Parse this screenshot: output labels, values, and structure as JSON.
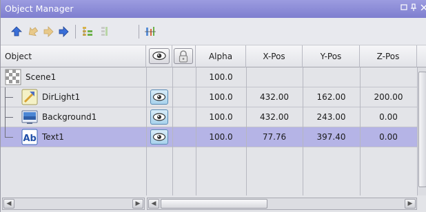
{
  "window": {
    "title": "Object Manager",
    "controls": [
      "maximize-icon",
      "pin-icon",
      "close-icon"
    ]
  },
  "toolbar": {
    "icons": [
      "move-up-icon",
      "move-left-icon",
      "move-right-icon",
      "move-down-icon",
      "expand-tree-icon",
      "collapse-tree-icon",
      "properties-icon"
    ]
  },
  "columns": {
    "object": "Object",
    "visible": "eye-icon",
    "lock": "lock-icon",
    "alpha": "Alpha",
    "xpos": "X-Pos",
    "ypos": "Y-Pos",
    "zpos": "Z-Pos"
  },
  "rows": [
    {
      "name": "Scene1",
      "icon": "scene-icon",
      "visible": false,
      "alpha": "100.0",
      "x": "",
      "y": "",
      "z": "",
      "selected": false
    },
    {
      "name": "DirLight1",
      "icon": "light-icon",
      "visible": true,
      "alpha": "100.0",
      "x": "432.00",
      "y": "162.00",
      "z": "200.00",
      "selected": false
    },
    {
      "name": "Background1",
      "icon": "background-icon",
      "visible": true,
      "alpha": "100.0",
      "x": "432.00",
      "y": "243.00",
      "z": "0.00",
      "selected": false
    },
    {
      "name": "Text1",
      "icon": "text-icon",
      "visible": true,
      "alpha": "100.0",
      "x": "77.76",
      "y": "397.40",
      "z": "0.00",
      "selected": true
    }
  ],
  "colors": {
    "titlebar": "#8a8ad6",
    "selected_row": "#b5b4e6",
    "background": "#e3e4e8"
  }
}
